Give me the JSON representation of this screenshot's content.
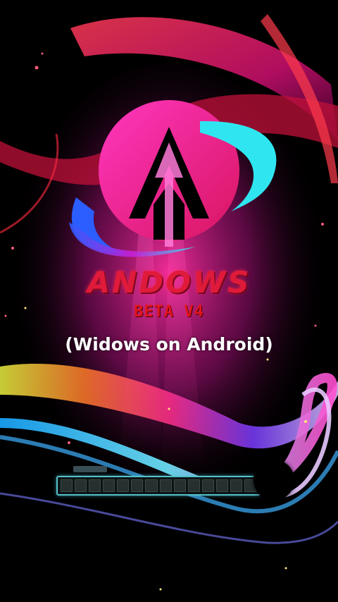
{
  "splash": {
    "brand_name": "ANDOWS",
    "brand_version": "BETA V4",
    "tagline": "(Widows on Android)"
  },
  "loader": {
    "segments_total": 14,
    "progress": 0
  },
  "colors": {
    "brand_red": "#e01a3a",
    "logo_magenta": "#e51e8c",
    "logo_cyan": "#2fe6f0",
    "logo_blue": "#2b5dff",
    "loader_accent": "#55c0c8"
  }
}
